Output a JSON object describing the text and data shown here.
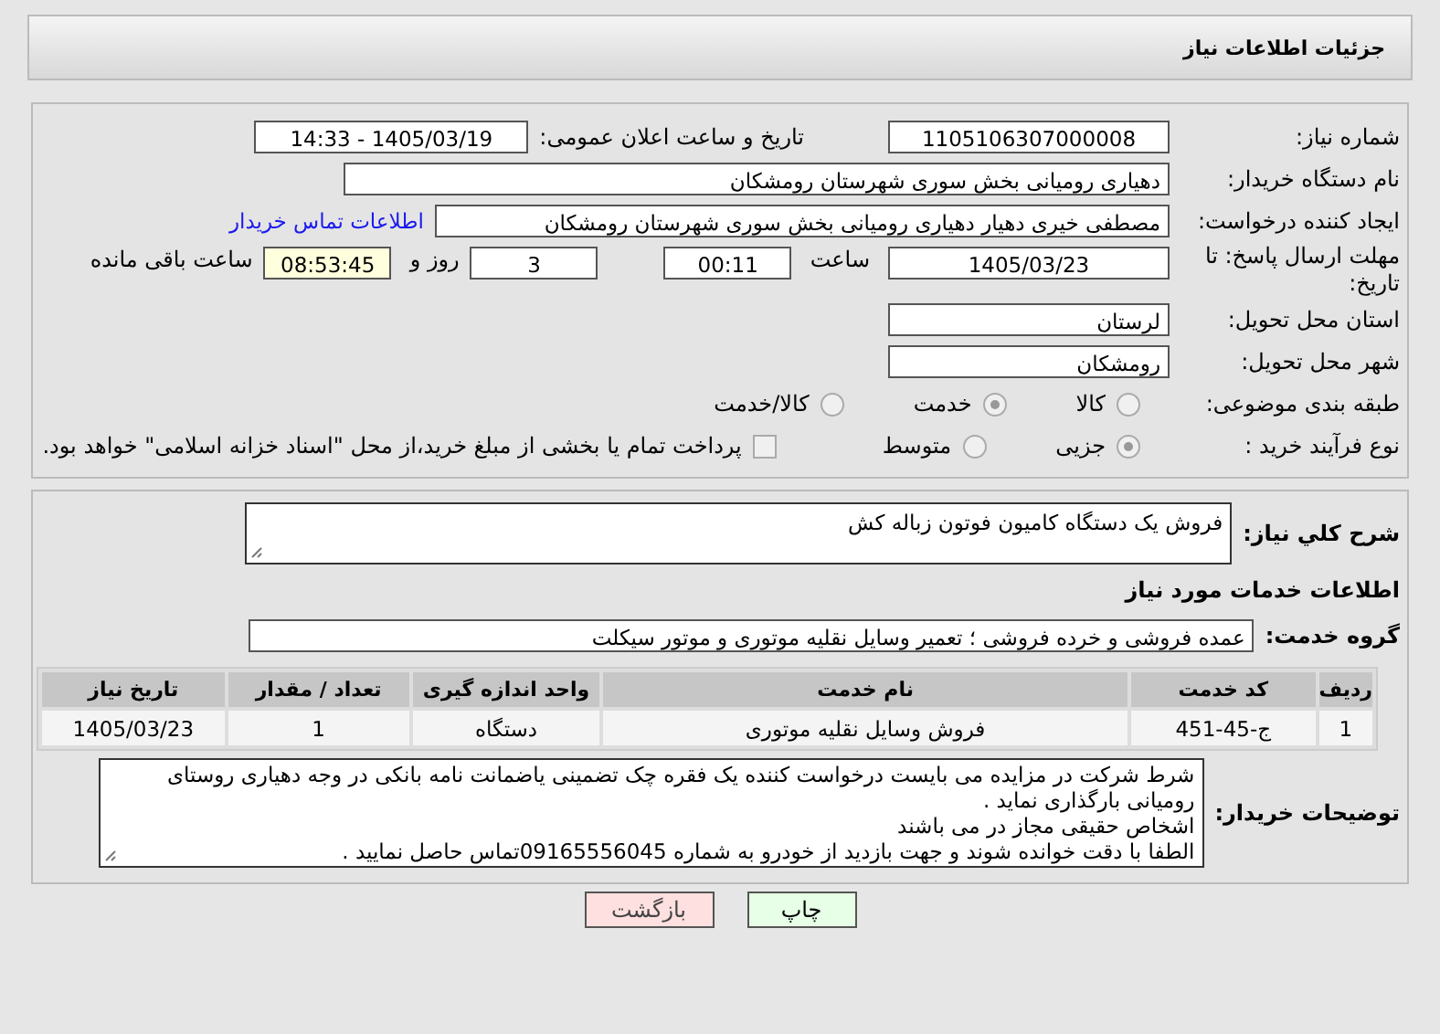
{
  "header": {
    "title": "جزئیات اطلاعات نیاز"
  },
  "need_info": {
    "need_number": {
      "label": "شماره نیاز:",
      "value": "1105106307000008"
    },
    "announce": {
      "label": "تاریخ و ساعت اعلان عمومی:",
      "value": "1405/03/19 - 14:33"
    },
    "buyer": {
      "label": "نام دستگاه خریدار:",
      "value": "دهیاری رومیانی بخش سوری شهرستان رومشکان"
    },
    "requester": {
      "label": "ایجاد کننده درخواست:",
      "value": "مصطفی خیری دهیار دهیاری رومیانی بخش سوری شهرستان رومشکان",
      "link": "اطلاعات تماس خریدار"
    },
    "deadline": {
      "label": "مهلت ارسال پاسخ: تا تاریخ:",
      "date": "1405/03/23",
      "time_label": "ساعت",
      "time": "00:11",
      "days": "3",
      "days_label": "روز و",
      "remaining": "08:53:45",
      "remaining_label": "ساعت باقی مانده"
    },
    "province": {
      "label": "استان محل تحویل:",
      "value": "لرستان"
    },
    "city": {
      "label": "شهر محل تحویل:",
      "value": "رومشکان"
    },
    "category": {
      "label": "طبقه بندی موضوعی:",
      "options": [
        {
          "label": "کالا",
          "selected": false
        },
        {
          "label": "خدمت",
          "selected": true
        },
        {
          "label": "کالا/خدمت",
          "selected": false
        }
      ]
    },
    "process": {
      "label": "نوع فرآیند خرید :",
      "options": [
        {
          "label": "جزیی",
          "selected": true
        },
        {
          "label": "متوسط",
          "selected": false
        }
      ],
      "payment": {
        "label": "پرداخت تمام یا بخشی از مبلغ خرید،از محل \"اسناد خزانه اسلامی\" خواهد بود.",
        "checked": false
      }
    }
  },
  "details": {
    "description": {
      "label": "شرح کلي نياز:",
      "value": "فروش یک دستگاه کامیون فوتون زباله کش"
    },
    "services_title": "اطلاعات خدمات مورد نياز",
    "service_group": {
      "label": "گروه خدمت:",
      "value": "عمده فروشی و خرده فروشی ؛ تعمیر وسایل نقلیه موتوری و موتور سیکلت"
    },
    "table": {
      "columns": [
        "ردیف",
        "کد خدمت",
        "نام خدمت",
        "واحد اندازه گیری",
        "تعداد / مقدار",
        "تاریخ نیاز"
      ],
      "rows": [
        [
          "1",
          "ج-45-451",
          "فروش وسایل نقلیه موتوری",
          "دستگاه",
          "1",
          "1405/03/23"
        ]
      ]
    },
    "buyer_notes": {
      "label": "توضیحات خریدار:",
      "lines": [
        "شرط شرکت در مزایده می بایست درخواست کننده یک فقره چک تضمینی یاضمانت نامه بانکی در وجه دهیاری روستای رومیانی بارگذاری نماید .",
        "اشخاص حقیقی مجاز در می باشند",
        "الطفا با دقت خوانده شوند و جهت بازدید از خودرو به شماره 09165556045تماس حاصل نمایید ."
      ]
    }
  },
  "buttons": [
    {
      "label": "چاپ",
      "kind": "print"
    },
    {
      "label": "بازگشت",
      "kind": "back"
    }
  ]
}
